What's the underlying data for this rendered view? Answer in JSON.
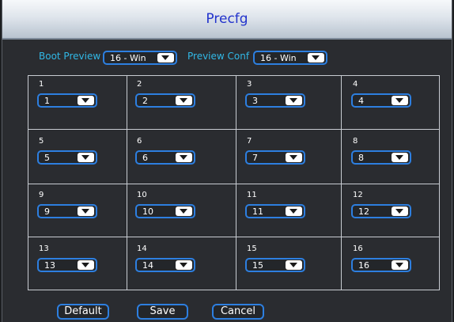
{
  "dialog": {
    "title": "Precfg"
  },
  "boot_preview": {
    "label": "Boot Preview",
    "value": "16 - Win"
  },
  "preview_conf": {
    "label": "Preview Conf",
    "value": "16 - Win"
  },
  "cells": [
    {
      "number": "1",
      "value": "1"
    },
    {
      "number": "2",
      "value": "2"
    },
    {
      "number": "3",
      "value": "3"
    },
    {
      "number": "4",
      "value": "4"
    },
    {
      "number": "5",
      "value": "5"
    },
    {
      "number": "6",
      "value": "6"
    },
    {
      "number": "7",
      "value": "7"
    },
    {
      "number": "8",
      "value": "8"
    },
    {
      "number": "9",
      "value": "9"
    },
    {
      "number": "10",
      "value": "10"
    },
    {
      "number": "11",
      "value": "11"
    },
    {
      "number": "12",
      "value": "12"
    },
    {
      "number": "13",
      "value": "13"
    },
    {
      "number": "14",
      "value": "14"
    },
    {
      "number": "15",
      "value": "15"
    },
    {
      "number": "16",
      "value": "16"
    }
  ],
  "buttons": {
    "default": "Default",
    "save": "Save",
    "cancel": "Cancel"
  },
  "colors": {
    "accent_border": "#2d7fe0",
    "label": "#31b8e6",
    "title": "#2233cc"
  }
}
